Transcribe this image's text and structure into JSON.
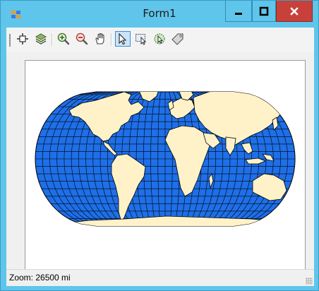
{
  "window": {
    "title": "Form1",
    "icon": "app-icon",
    "caption_buttons": [
      "minimize",
      "maximize",
      "close"
    ]
  },
  "toolbar": {
    "tools": [
      {
        "name": "pan-extent-icon",
        "label": "Full Extent"
      },
      {
        "name": "layers-icon",
        "label": "Layers"
      },
      {
        "name": "zoom-in-icon",
        "label": "Zoom In"
      },
      {
        "name": "zoom-out-icon",
        "label": "Zoom Out"
      },
      {
        "name": "pan-hand-icon",
        "label": "Pan"
      },
      {
        "name": "select-arrow-icon",
        "label": "Select",
        "active": true
      },
      {
        "name": "select-rect-icon",
        "label": "Select by Rectangle"
      },
      {
        "name": "identify-icon",
        "label": "Identify"
      },
      {
        "name": "label-tag-icon",
        "label": "Label"
      }
    ]
  },
  "map": {
    "projection": "Robinson",
    "ocean_color": "#1e6fe8",
    "land_color": "#fff2c9",
    "graticule_color": "#000000"
  },
  "statusbar": {
    "zoom_text": "Zoom: 26500 mi"
  }
}
